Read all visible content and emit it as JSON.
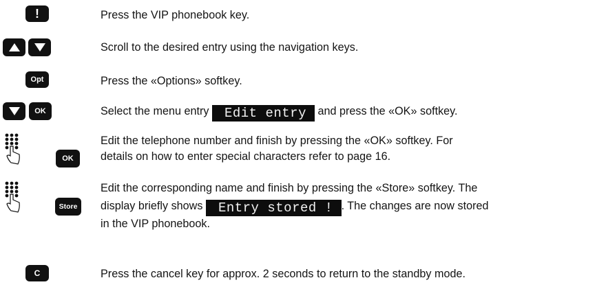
{
  "steps": [
    {
      "text": "Press the VIP phonebook key.",
      "keys": [
        "!"
      ]
    },
    {
      "text": "Scroll to the desired entry using the navigation keys.",
      "keys": [
        "up-arrow",
        "down-arrow"
      ]
    },
    {
      "text": "Press the «Options» softkey.",
      "keys": [
        "Opt"
      ]
    },
    {
      "text_before": "Select the menu entry",
      "display": "Edit entry",
      "text_after": "and press the «OK» softkey.",
      "keys": [
        "down-arrow",
        "OK"
      ]
    },
    {
      "line1": "Edit the telephone number and finish by pressing the «OK» softkey. For",
      "line2": "details on how to enter special characters refer to page 16.",
      "keys": [
        "keypad",
        "OK"
      ]
    },
    {
      "line1": "Edit the corresponding  name and finish by pressing the «Store» softkey. The",
      "line2_before": "display briefly shows",
      "display": "Entry stored !",
      "line2_after": ". The changes are now stored",
      "line3": "in the VIP phonebook.",
      "keys": [
        "keypad",
        "Store"
      ]
    },
    {
      "text": "Press the cancel key for approx. 2 seconds to return to the standby mode.",
      "keys": [
        "C"
      ]
    }
  ],
  "icons": {
    "keypad": "keypad-icon",
    "arrow_up": "up-arrow-icon",
    "arrow_down": "down-arrow-icon"
  },
  "key_labels": {
    "vip": "!",
    "opt": "Opt",
    "ok": "OK",
    "store": "Store",
    "cancel": "C"
  },
  "colors": {
    "key": "#111111",
    "display_bg": "#0d0d0d",
    "text": "#141414"
  }
}
